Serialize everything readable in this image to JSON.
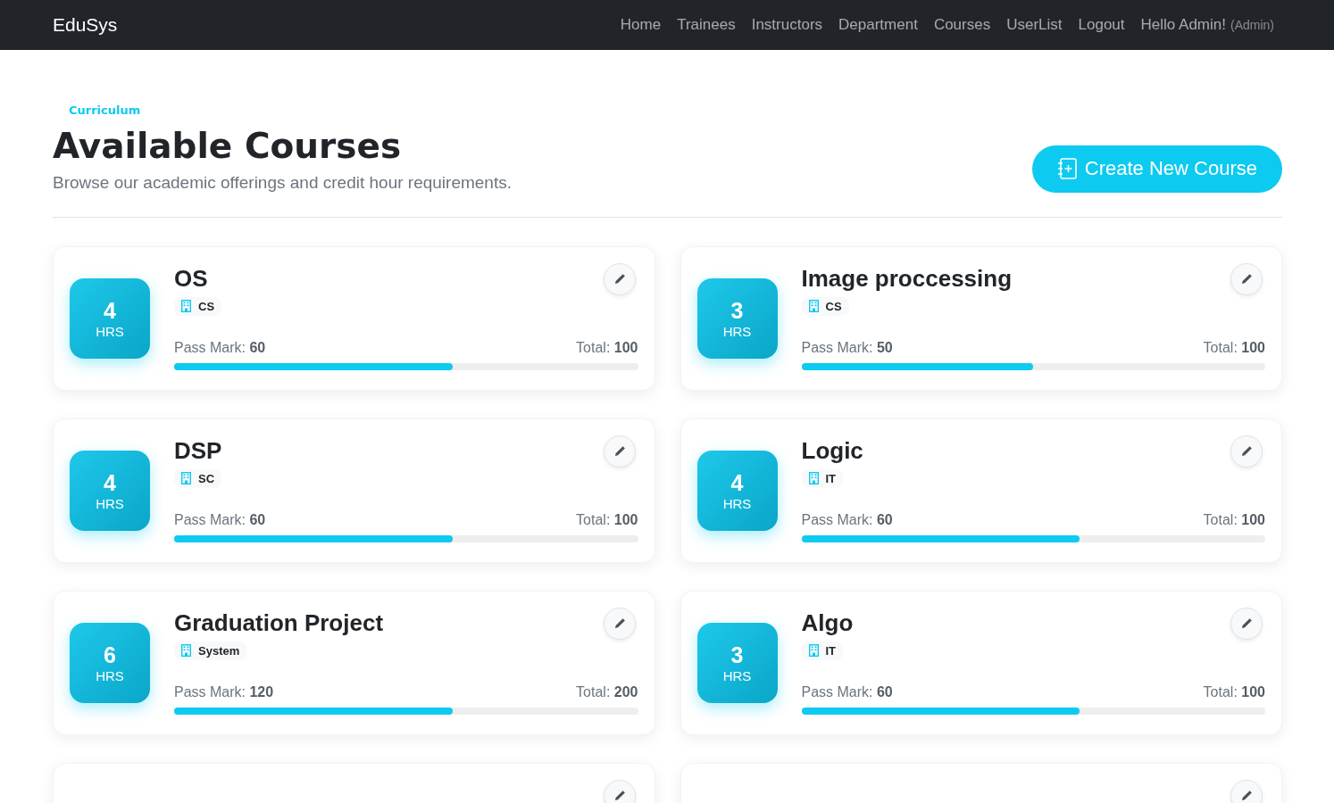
{
  "navbar": {
    "brand": "EduSys",
    "links": [
      "Home",
      "Trainees",
      "Instructors",
      "Department",
      "Courses",
      "UserList",
      "Logout"
    ],
    "greeting": "Hello Admin!",
    "role": "(Admin)"
  },
  "header": {
    "eyebrow": "Curriculum",
    "title": "Available Courses",
    "subtitle": "Browse our academic offerings and credit hour requirements.",
    "create_button": "Create New Course"
  },
  "courses": [
    {
      "hours": "4",
      "hours_unit": "HRS",
      "name": "OS",
      "department": "CS",
      "pass_label": "Pass Mark:",
      "pass_mark": "60",
      "total_label": "Total:",
      "total": "100",
      "level": 0.6
    },
    {
      "hours": "3",
      "hours_unit": "HRS",
      "name": "Image proccessing",
      "department": "CS",
      "pass_label": "Pass Mark:",
      "pass_mark": "50",
      "total_label": "Total:",
      "total": "100",
      "level": 0.5
    },
    {
      "hours": "4",
      "hours_unit": "HRS",
      "name": "DSP",
      "department": "SC",
      "pass_label": "Pass Mark:",
      "pass_mark": "60",
      "total_label": "Total:",
      "total": "100",
      "level": 0.6
    },
    {
      "hours": "4",
      "hours_unit": "HRS",
      "name": "Logic",
      "department": "IT",
      "pass_label": "Pass Mark:",
      "pass_mark": "60",
      "total_label": "Total:",
      "total": "100",
      "level": 0.6
    },
    {
      "hours": "6",
      "hours_unit": "HRS",
      "name": "Graduation Project",
      "department": "System",
      "pass_label": "Pass Mark:",
      "pass_mark": "120",
      "total_label": "Total:",
      "total": "200",
      "level": 0.6
    },
    {
      "hours": "3",
      "hours_unit": "HRS",
      "name": "Algo",
      "department": "IT",
      "pass_label": "Pass Mark:",
      "pass_mark": "60",
      "total_label": "Total:",
      "total": "100",
      "level": 0.6
    },
    {
      "partial": true
    },
    {
      "partial": true
    }
  ]
}
